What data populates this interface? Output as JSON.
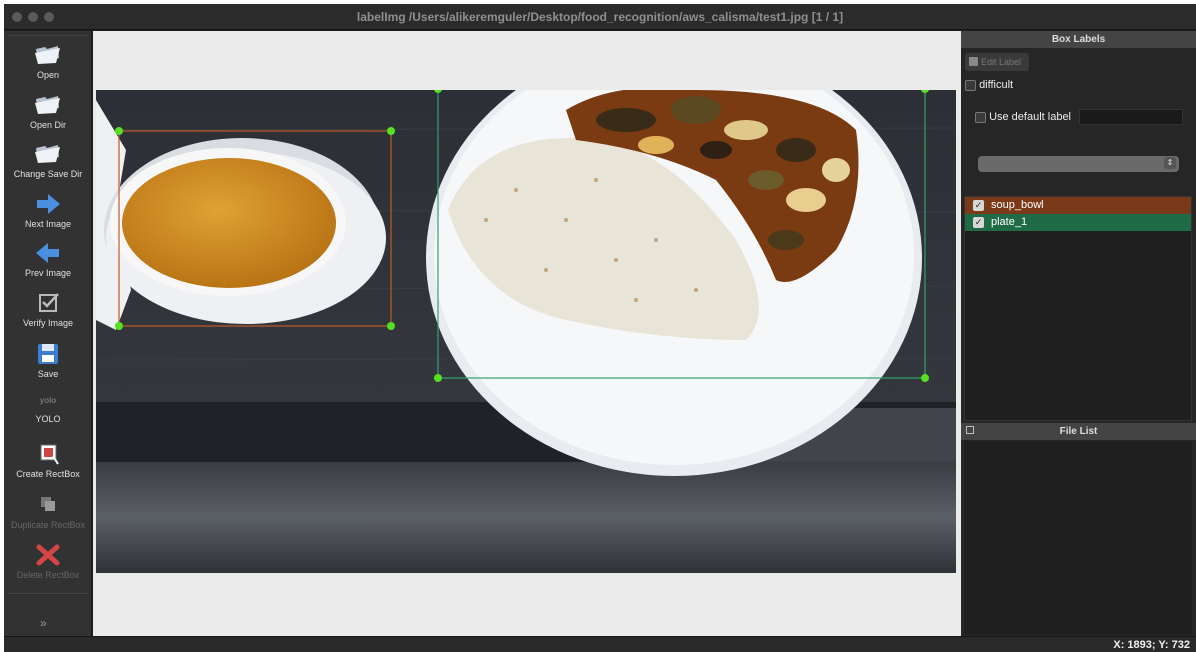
{
  "window": {
    "title": "labelImg /Users/alikeremguler/Desktop/food_recognition/aws_calisma/test1.jpg [1 / 1]"
  },
  "toolbar": {
    "items": [
      {
        "label": "Open",
        "icon": "folder-open-icon",
        "enabled": true
      },
      {
        "label": "Open Dir",
        "icon": "folder-open-icon",
        "enabled": true
      },
      {
        "label": "Change Save Dir",
        "icon": "folder-open-icon",
        "enabled": true
      },
      {
        "label": "Next Image",
        "icon": "arrow-right-icon",
        "enabled": true
      },
      {
        "label": "Prev Image",
        "icon": "arrow-left-icon",
        "enabled": true
      },
      {
        "label": "Verify Image",
        "icon": "checkbox-icon",
        "enabled": true
      },
      {
        "label": "Save",
        "icon": "floppy-disk-icon",
        "enabled": true
      },
      {
        "label": "YOLO",
        "icon_text": "yolo",
        "enabled": true
      },
      {
        "label": "Create RectBox",
        "icon": "create-rectbox-icon",
        "enabled": true
      },
      {
        "label": "Duplicate RectBox",
        "icon": "duplicate-icon",
        "enabled": false
      },
      {
        "label": "Delete RectBox",
        "icon": "delete-x-icon",
        "enabled": false
      }
    ],
    "more_icon": "expand-chevron-icon"
  },
  "canvas": {
    "boxes": [
      {
        "label": "soup_bowl",
        "color": "#c0582a"
      },
      {
        "label": "plate_1",
        "color": "#2fa36b"
      }
    ],
    "handle_color": "#55e022"
  },
  "dock": {
    "box_labels_title": "Box Labels",
    "edit_label": "Edit Label",
    "difficult_label": "difficult",
    "use_default_label": "Use default label",
    "default_label_value": "",
    "labels": [
      {
        "name": "soup_bowl",
        "checked": true,
        "bg": "#7a3a1a"
      },
      {
        "name": "plate_1",
        "checked": true,
        "bg": "#1f6b46"
      }
    ],
    "file_list_title": "File List",
    "files": []
  },
  "status": {
    "coords": "X: 1893; Y: 732"
  }
}
